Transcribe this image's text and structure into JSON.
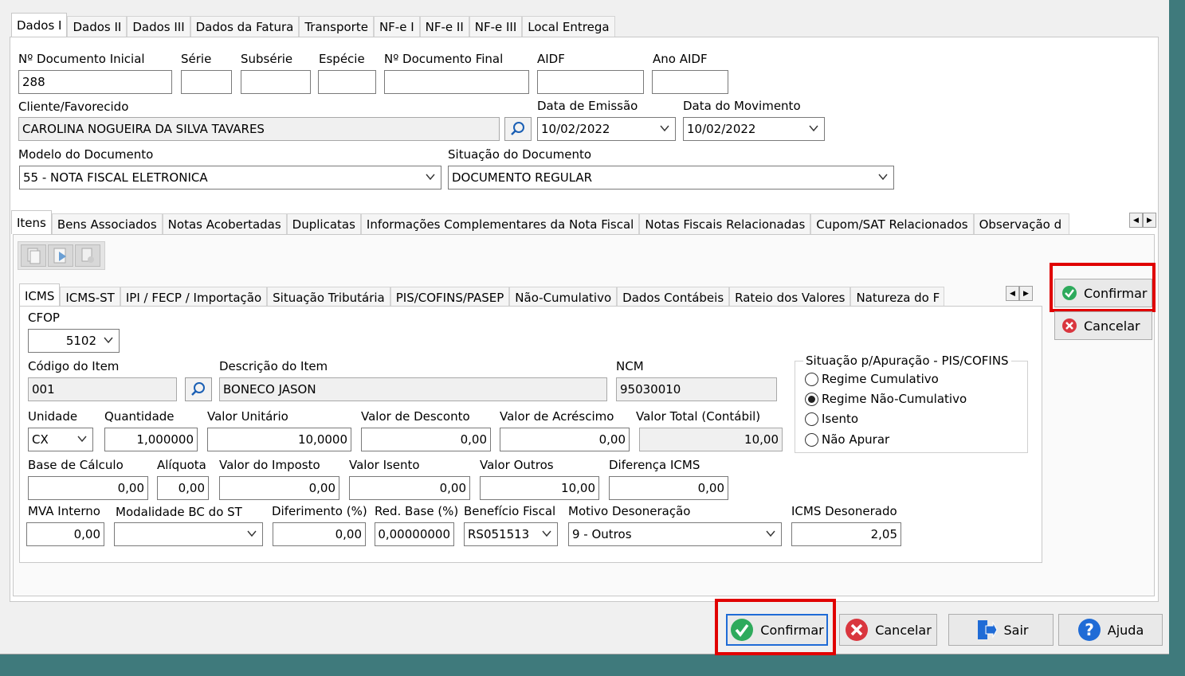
{
  "top_tabs": [
    "Dados I",
    "Dados II",
    "Dados III",
    "Dados da Fatura",
    "Transporte",
    "NF-e I",
    "NF-e II",
    "NF-e III",
    "Local Entrega"
  ],
  "header": {
    "doc_inicial_label": "Nº Documento Inicial",
    "doc_inicial": "288",
    "serie_label": "Série",
    "serie": "",
    "subserie_label": "Subsérie",
    "subserie": "",
    "especie_label": "Espécie",
    "especie": "",
    "doc_final_label": "Nº Documento Final",
    "doc_final": "",
    "aidf_label": "AIDF",
    "aidf": "",
    "ano_aidf_label": "Ano AIDF",
    "ano_aidf": "",
    "cliente_label": "Cliente/Favorecido",
    "cliente": "CAROLINA NOGUEIRA DA SILVA TAVARES",
    "emissao_label": "Data de Emissão",
    "emissao": "10/02/2022",
    "movimento_label": "Data do Movimento",
    "movimento": "10/02/2022",
    "modelo_label": "Modelo do Documento",
    "modelo": "55 - NOTA FISCAL ELETRONICA",
    "situacao_label": "Situação do Documento",
    "situacao": "DOCUMENTO REGULAR"
  },
  "mid_tabs": [
    "Itens",
    "Bens Associados",
    "Notas Acobertadas",
    "Duplicatas",
    "Informações Complementares da Nota Fiscal",
    "Notas Fiscais Relacionadas",
    "Cupom/SAT Relacionados",
    "Observação d"
  ],
  "item_tabs": [
    "ICMS",
    "ICMS-ST",
    "IPI / FECP / Importação",
    "Situação Tributária",
    "PIS/COFINS/PASEP",
    "Não-Cumulativo",
    "Dados Contábeis",
    "Rateio dos Valores",
    "Natureza do F"
  ],
  "icms": {
    "cfop_label": "CFOP",
    "cfop": "5102",
    "codigo_label": "Código do Item",
    "codigo": "001",
    "descricao_label": "Descrição do Item",
    "descricao": "BONECO JASON",
    "ncm_label": "NCM",
    "ncm": "95030010",
    "unidade_label": "Unidade",
    "unidade": "CX",
    "quantidade_label": "Quantidade",
    "quantidade": "1,000000",
    "valor_unitario_label": "Valor Unitário",
    "valor_unitario": "10,0000",
    "desconto_label": "Valor de Desconto",
    "desconto": "0,00",
    "acrescimo_label": "Valor de Acréscimo",
    "acrescimo": "0,00",
    "total_label": "Valor Total (Contábil)",
    "total": "10,00",
    "base_label": "Base de Cálculo",
    "base": "0,00",
    "aliquota_label": "Alíquota",
    "aliquota": "0,00",
    "imposto_label": "Valor do Imposto",
    "imposto": "0,00",
    "isento_label": "Valor Isento",
    "isento": "0,00",
    "outros_label": "Valor Outros",
    "outros": "10,00",
    "diferenca_label": "Diferença ICMS",
    "diferenca": "0,00",
    "mva_label": "MVA Interno",
    "mva": "0,00",
    "modalidade_label": "Modalidade BC do ST",
    "modalidade": "",
    "diferimento_label": "Diferimento (%)",
    "diferimento": "0,00",
    "red_base_label": "Red. Base (%)",
    "red_base": "0,00000000",
    "beneficio_label": "Benefício Fiscal",
    "beneficio": "RS051513",
    "motivo_label": "Motivo Desoneração",
    "motivo": "9 - Outros",
    "desonerado_label": "ICMS Desonerado",
    "desonerado": "2,05"
  },
  "apuracao": {
    "title": "Situação p/Apuração - PIS/COFINS",
    "options": [
      "Regime Cumulativo",
      "Regime Não-Cumulativo",
      "Isento",
      "Não Apurar"
    ],
    "selected": "Regime Não-Cumulativo"
  },
  "side_buttons": {
    "confirm": "Confirmar",
    "cancel": "Cancelar"
  },
  "bottom_buttons": {
    "confirm": "Confirmar",
    "cancel": "Cancelar",
    "exit": "Sair",
    "help": "Ajuda"
  },
  "colors": {
    "highlight": "#e00000",
    "confirm_green": "#2eaa5c",
    "cancel_red": "#d9363e",
    "help_blue": "#1f6bd6",
    "background": "#3f7a7c"
  }
}
